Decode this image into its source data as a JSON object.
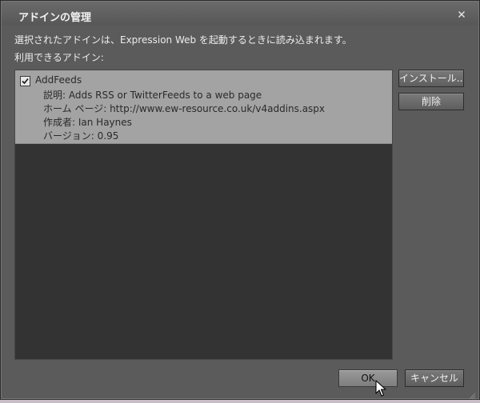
{
  "dialog": {
    "title": "アドインの管理",
    "description": "選択されたアドインは、Expression Web を起動するときに読み込まれます。",
    "available_label": "利用できるアドイン:"
  },
  "addins": [
    {
      "name": "AddFeeds",
      "checked": true,
      "description": "説明: Adds RSS or TwitterFeeds to a web page",
      "homepage": "ホーム ページ: http://www.ew-resource.co.uk/v4addins.aspx",
      "author": "作成者: Ian Haynes",
      "version": "バージョン: 0.95"
    }
  ],
  "buttons": {
    "install": "インストール...",
    "delete": "削除",
    "ok": "OK",
    "cancel": "キャンセル"
  },
  "icons": {
    "close": "close-icon",
    "check": "check-icon",
    "cursor": "mouse-pointer-icon",
    "grip": "resize-grip-icon"
  }
}
